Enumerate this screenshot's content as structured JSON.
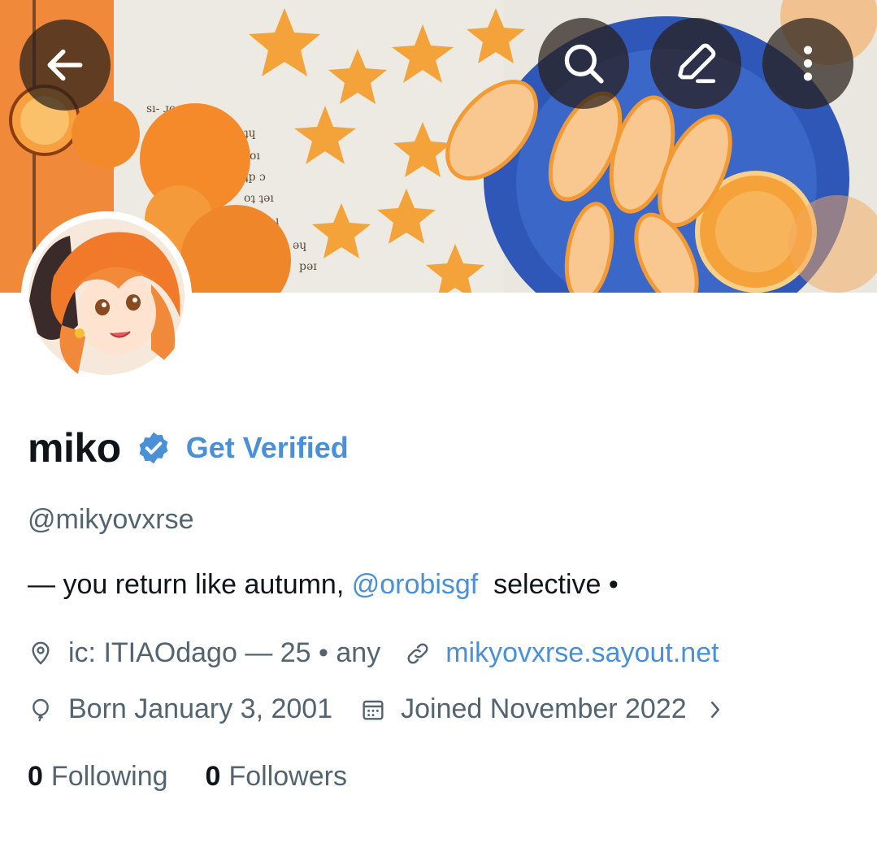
{
  "profile": {
    "display_name": "miko",
    "get_verified_label": "Get Verified",
    "handle": "@mikyovxrse",
    "bio_prefix": "— you return like autumn, ",
    "bio_mention": "@orobisgf",
    "bio_suffix": "  selective •",
    "location": "ic: ITIAOdago — 25 • any",
    "website": "mikyovxrse.sayout.net",
    "born": "Born January 3, 2001",
    "joined": "Joined November 2022",
    "following_count": "0",
    "following_label": "Following",
    "followers_count": "0",
    "followers_label": "Followers"
  },
  "icons": {
    "back": "arrow-left-icon",
    "search": "search-icon",
    "edit": "edit-pencil-icon",
    "more": "more-vertical-icon",
    "verified": "verified-badge-icon",
    "location": "location-pin-icon",
    "link": "link-icon",
    "birthday": "balloon-icon",
    "joined": "calendar-icon",
    "chevron": "chevron-right-icon"
  },
  "colors": {
    "accent": "#4a90d6",
    "text_primary": "#0f1419",
    "text_secondary": "#536471",
    "header_button_bg": "#2a1f19"
  }
}
